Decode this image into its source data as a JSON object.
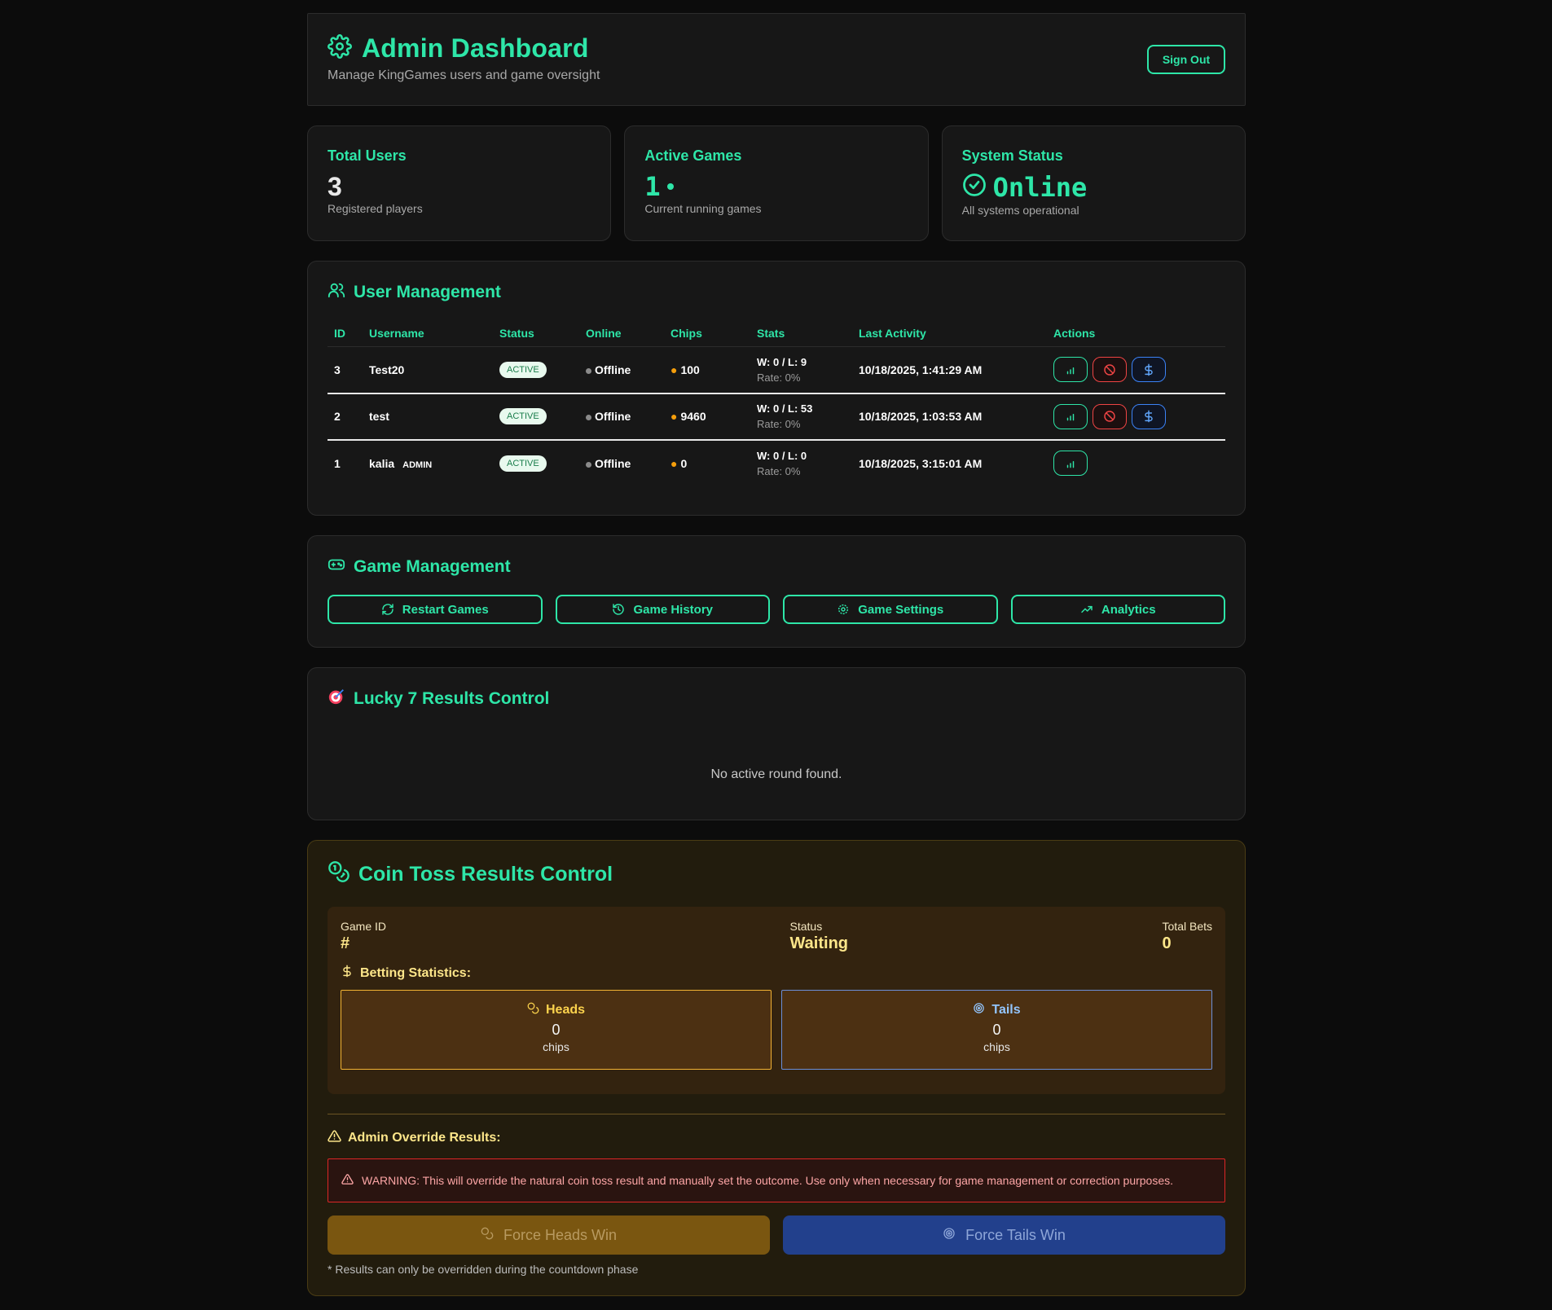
{
  "header": {
    "title": "Admin Dashboard",
    "subtitle": "Manage KingGames users and game oversight",
    "sign_out": "Sign Out"
  },
  "stats": {
    "total_users": {
      "label": "Total Users",
      "value": "3",
      "sub": "Registered players"
    },
    "active_games": {
      "label": "Active Games",
      "value": "1",
      "sub": "Current running games"
    },
    "system_status": {
      "label": "System Status",
      "value": "Online",
      "sub": "All systems operational"
    }
  },
  "user_management": {
    "title": "User Management",
    "columns": [
      "ID",
      "Username",
      "Status",
      "Online",
      "Chips",
      "Stats",
      "Last Activity",
      "Actions"
    ],
    "rows": [
      {
        "id": "3",
        "username": "Test20",
        "admin": "",
        "status": "ACTIVE",
        "online": "Offline",
        "chips": "100",
        "wl": "W: 0 / L: 9",
        "rate": "Rate: 0%",
        "last": "10/18/2025, 1:41:29 AM"
      },
      {
        "id": "2",
        "username": "test",
        "admin": "",
        "status": "ACTIVE",
        "online": "Offline",
        "chips": "9460",
        "wl": "W: 0 / L: 53",
        "rate": "Rate: 0%",
        "last": "10/18/2025, 1:03:53 AM"
      },
      {
        "id": "1",
        "username": "kalia",
        "admin": "ADMIN",
        "status": "ACTIVE",
        "online": "Offline",
        "chips": "0",
        "wl": "W: 0 / L: 0",
        "rate": "Rate: 0%",
        "last": "10/18/2025, 3:15:01 AM"
      }
    ]
  },
  "game_management": {
    "title": "Game Management",
    "buttons": [
      "Restart Games",
      "Game History",
      "Game Settings",
      "Analytics"
    ]
  },
  "lucky7": {
    "title": "Lucky 7 Results Control",
    "empty": "No active round found."
  },
  "coin_toss": {
    "title": "Coin Toss Results Control",
    "game_id_label": "Game ID",
    "game_id_value": "#",
    "status_label": "Status",
    "status_value": "Waiting",
    "total_bets_label": "Total Bets",
    "total_bets_value": "0",
    "betting_stats_title": "Betting Statistics:",
    "heads": {
      "label": "Heads",
      "value": "0",
      "unit": "chips"
    },
    "tails": {
      "label": "Tails",
      "value": "0",
      "unit": "chips"
    },
    "override_title": "Admin Override Results:",
    "warning": "WARNING: This will override the natural coin toss result and manually set the outcome.  Use only when necessary for game management or correction purposes.",
    "force_heads": "Force Heads Win",
    "force_tails": "Force Tails Win",
    "footnote": "* Results can only be overridden during the countdown phase"
  },
  "colors": {
    "accent": "#2ee6a8",
    "background": "#0c0c0c",
    "card": "#171717",
    "heads": "#7a5610",
    "tails": "#22408c"
  }
}
